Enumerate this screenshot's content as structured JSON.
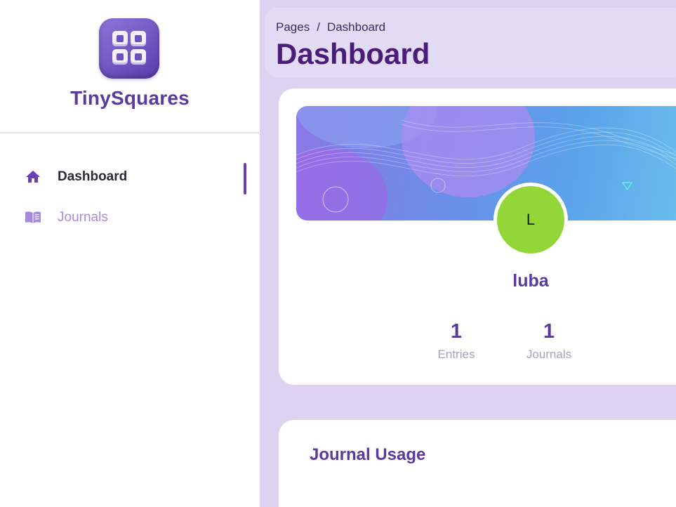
{
  "app": {
    "brand": "TinySquares",
    "logo_icon": "app-grid-icon"
  },
  "colors": {
    "accent": "#5b3a9e",
    "title": "#4a1d7a",
    "avatar_bg": "#92d737",
    "background": "#ddd3f0"
  },
  "sidebar": {
    "items": [
      {
        "label": "Dashboard",
        "icon": "home-icon",
        "active": true
      },
      {
        "label": "Journals",
        "icon": "book-icon",
        "active": false
      }
    ]
  },
  "header": {
    "breadcrumb": [
      "Pages",
      "/",
      "Dashboard"
    ],
    "title": "Dashboard"
  },
  "profile": {
    "avatar_initial": "L",
    "username": "luba",
    "stats": [
      {
        "value": "1",
        "label": "Entries"
      },
      {
        "value": "1",
        "label": "Journals"
      }
    ]
  },
  "usage": {
    "title": "Journal Usage"
  }
}
